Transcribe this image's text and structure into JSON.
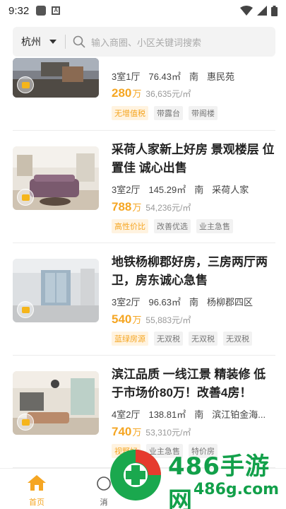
{
  "status_bar": {
    "time": "9:32"
  },
  "search": {
    "city": "杭州",
    "placeholder": "输入商圈、小区关键词搜索"
  },
  "listings": [
    {
      "title": "",
      "layout": "3室1厅",
      "area": "76.43㎡",
      "orientation": "南",
      "community": "惠民苑",
      "price": "280",
      "price_unit": "万",
      "unit_price": "36,635元/㎡",
      "tags": [
        {
          "text": "无增值税",
          "highlight": true
        },
        {
          "text": "带露台",
          "highlight": false
        },
        {
          "text": "带阁楼",
          "highlight": false
        }
      ]
    },
    {
      "title": "采荷人家新上好房 景观楼层 位置佳 诚心出售",
      "layout": "3室2厅",
      "area": "145.29㎡",
      "orientation": "南",
      "community": "采荷人家",
      "price": "788",
      "price_unit": "万",
      "unit_price": "54,236元/㎡",
      "tags": [
        {
          "text": "高性价比",
          "highlight": true
        },
        {
          "text": "改善优选",
          "highlight": false
        },
        {
          "text": "业主急售",
          "highlight": false
        }
      ]
    },
    {
      "title": "地铁杨柳郡好房，三房两厅两卫，房东诚心急售",
      "layout": "3室2厅",
      "area": "96.63㎡",
      "orientation": "南",
      "community": "杨柳郡四区",
      "price": "540",
      "price_unit": "万",
      "unit_price": "55,883元/㎡",
      "tags": [
        {
          "text": "蓝绿房源",
          "highlight": true
        },
        {
          "text": "无双税",
          "highlight": false
        },
        {
          "text": "无双税",
          "highlight": false
        },
        {
          "text": "无双税",
          "highlight": false
        }
      ]
    },
    {
      "title": "滨江品质 一线江景 精装修 低于市场价80万！改善4房！",
      "layout": "4室2厅",
      "area": "138.81㎡",
      "orientation": "南",
      "community": "滨江铂金海...",
      "price": "740",
      "price_unit": "万",
      "unit_price": "53,310元/㎡",
      "tags": [
        {
          "text": "视野好",
          "highlight": true
        },
        {
          "text": "业主急售",
          "highlight": false
        },
        {
          "text": "特价房",
          "highlight": false
        }
      ]
    }
  ],
  "tabbar": {
    "home": "首页",
    "messages": "消"
  },
  "watermark": {
    "brand": "486手游网",
    "url": "486g.com"
  },
  "colors": {
    "accent": "#f5a623",
    "watermark_green": "#12a04a"
  }
}
